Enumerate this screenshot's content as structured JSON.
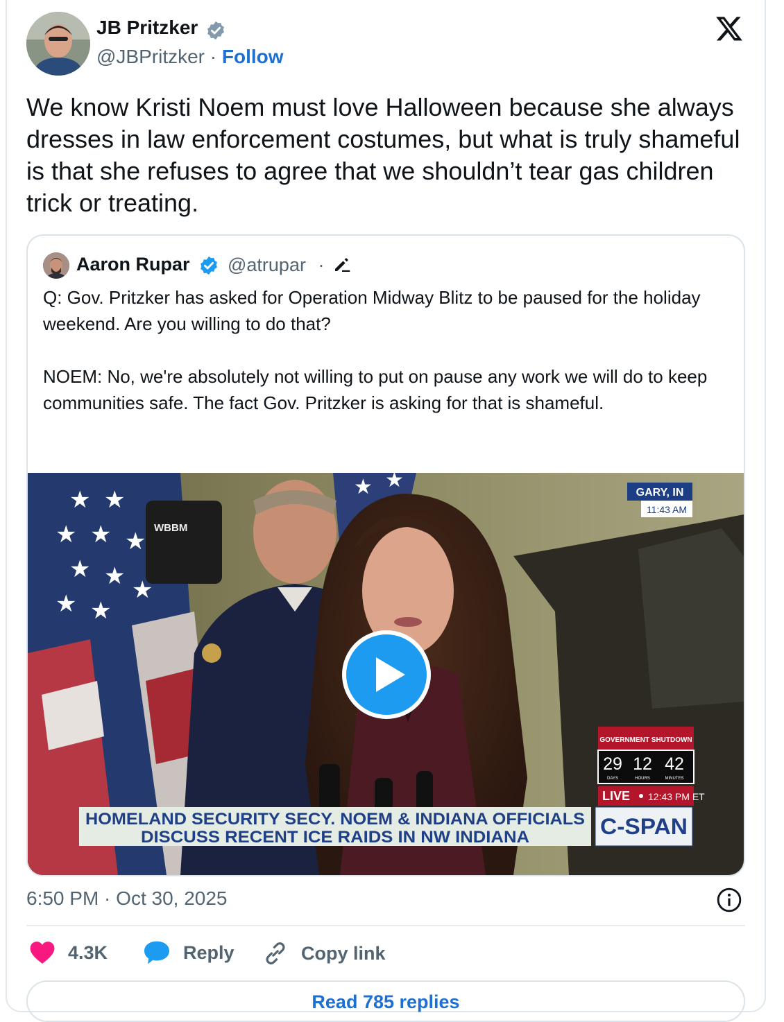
{
  "tweet": {
    "author_name": "JB Pritzker",
    "author_handle": "@JBPritzker",
    "separator": "·",
    "follow_label": "Follow",
    "text": "We know Kristi Noem must love Halloween because she always dresses in law enforcement costumes, but what is truly shameful is that she refuses to agree that we shouldn’t tear gas children trick or treating.",
    "timestamp": "6:50 PM · Oct 30, 2025"
  },
  "quote": {
    "author_name": "Aaron Rupar",
    "author_handle": "@atrupar",
    "separator": "·",
    "text": "Q: Gov. Pritzker has asked for Operation Midway Blitz to be paused for the holiday weekend. Are you willing to do that?\n\nNOEM: No, we're absolutely not willing to put on pause any work we will do to keep communities safe. The fact Gov. Pritzker is asking for that is shameful."
  },
  "video": {
    "location": "GARY, IN",
    "local_time": "11:43 AM",
    "station": "WBBM",
    "shutdown_title": "GOVERNMENT SHUTDOWN",
    "shutdown_values": [
      "29",
      "12",
      "42"
    ],
    "shutdown_units": [
      "DAYS",
      "HOURS",
      "MINUTES"
    ],
    "live_label": "LIVE",
    "live_time": "12:43 PM ET",
    "chyron_line1": "HOMELAND SECURITY SECY. NOEM & INDIANA OFFICIALS",
    "chyron_line2": "DISCUSS RECENT ICE RAIDS IN NW INDIANA",
    "network": "C-SPAN"
  },
  "actions": {
    "like_count": "4.3K",
    "reply_label": "Reply",
    "copy_label": "Copy link"
  },
  "read_replies_label": "Read 785 replies",
  "colors": {
    "accent": "#1d9bf0",
    "like": "#f91880",
    "follow": "#1d6fd1"
  },
  "icons": [
    "verified-badge-icon",
    "x-logo-icon",
    "edit-pencil-icon",
    "play-icon",
    "info-icon",
    "heart-icon",
    "reply-bubble-icon",
    "link-icon"
  ]
}
